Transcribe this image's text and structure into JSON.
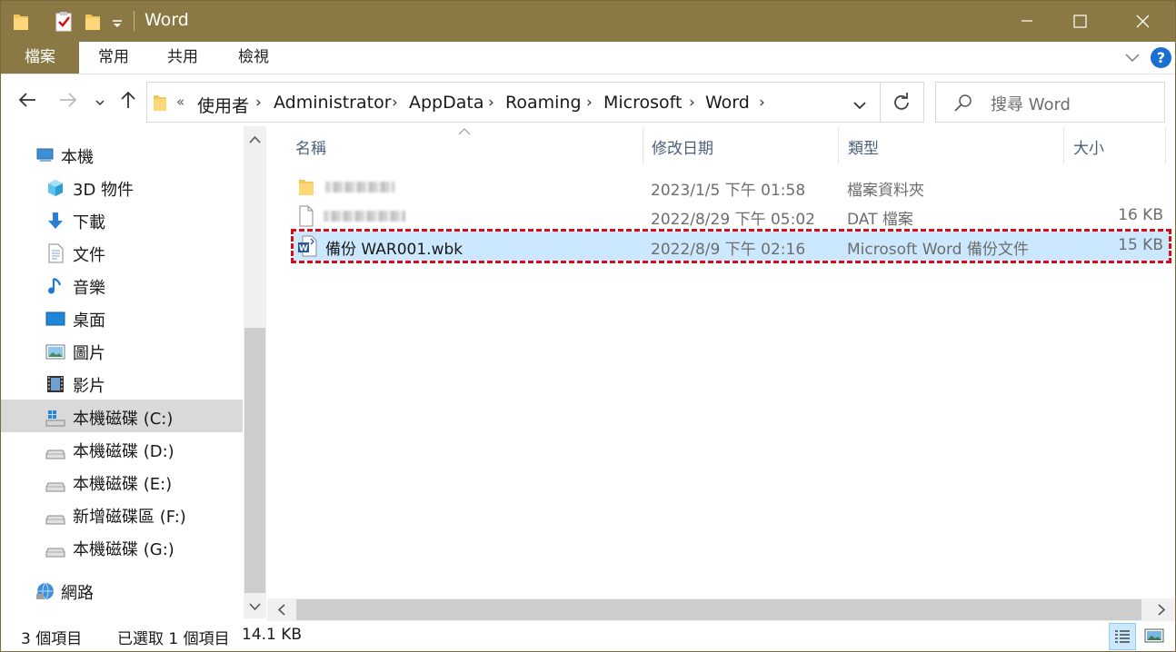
{
  "window": {
    "title": "Word"
  },
  "ribbon": {
    "tabs": [
      "檔案",
      "常用",
      "共用",
      "檢視"
    ],
    "help": "?"
  },
  "address": {
    "prefix": "«",
    "crumbs": [
      "使用者",
      "Administrator",
      "AppData",
      "Roaming",
      "Microsoft",
      "Word"
    ]
  },
  "search": {
    "placeholder": "搜尋 Word"
  },
  "sidebar": {
    "items": [
      {
        "label": "本機",
        "icon": "computer-icon"
      },
      {
        "label": "3D 物件",
        "icon": "cube-icon"
      },
      {
        "label": "下載",
        "icon": "download-arrow-icon"
      },
      {
        "label": "文件",
        "icon": "document-icon"
      },
      {
        "label": "音樂",
        "icon": "music-note-icon"
      },
      {
        "label": "桌面",
        "icon": "desktop-icon"
      },
      {
        "label": "圖片",
        "icon": "picture-icon"
      },
      {
        "label": "影片",
        "icon": "film-icon"
      },
      {
        "label": "本機磁碟 (C:)",
        "icon": "system-drive-icon",
        "selected": true
      },
      {
        "label": "本機磁碟 (D:)",
        "icon": "drive-icon"
      },
      {
        "label": "本機磁碟 (E:)",
        "icon": "drive-icon"
      },
      {
        "label": "新增磁碟區 (F:)",
        "icon": "drive-icon"
      },
      {
        "label": "本機磁碟 (G:)",
        "icon": "drive-icon"
      },
      {
        "label": "網路",
        "icon": "network-icon"
      }
    ]
  },
  "columns": {
    "name": "名稱",
    "modified": "修改日期",
    "type": "類型",
    "size": "大小"
  },
  "files": [
    {
      "name": "",
      "modified": "2023/1/5 下午 01:58",
      "type": "檔案資料夾",
      "size": "",
      "icon": "folder-icon",
      "blurred": true
    },
    {
      "name": "",
      "modified": "2022/8/29 下午 05:02",
      "type": "DAT 檔案",
      "size": "16 KB",
      "icon": "blank-file-icon",
      "blurred": true
    },
    {
      "name": "備份 WAR001.wbk",
      "modified": "2022/8/9 下午 02:16",
      "type": "Microsoft Word 備份文件",
      "size": "15 KB",
      "icon": "word-backup-icon",
      "selected": true
    }
  ],
  "status": {
    "count": "3 個項目",
    "selected": "已選取 1 個項目",
    "size": "14.1 KB"
  },
  "colors": {
    "titlebar": "#8a7944",
    "selection": "#cce8ff",
    "highlight_border": "#d2101c",
    "help": "#1a6fd1"
  }
}
